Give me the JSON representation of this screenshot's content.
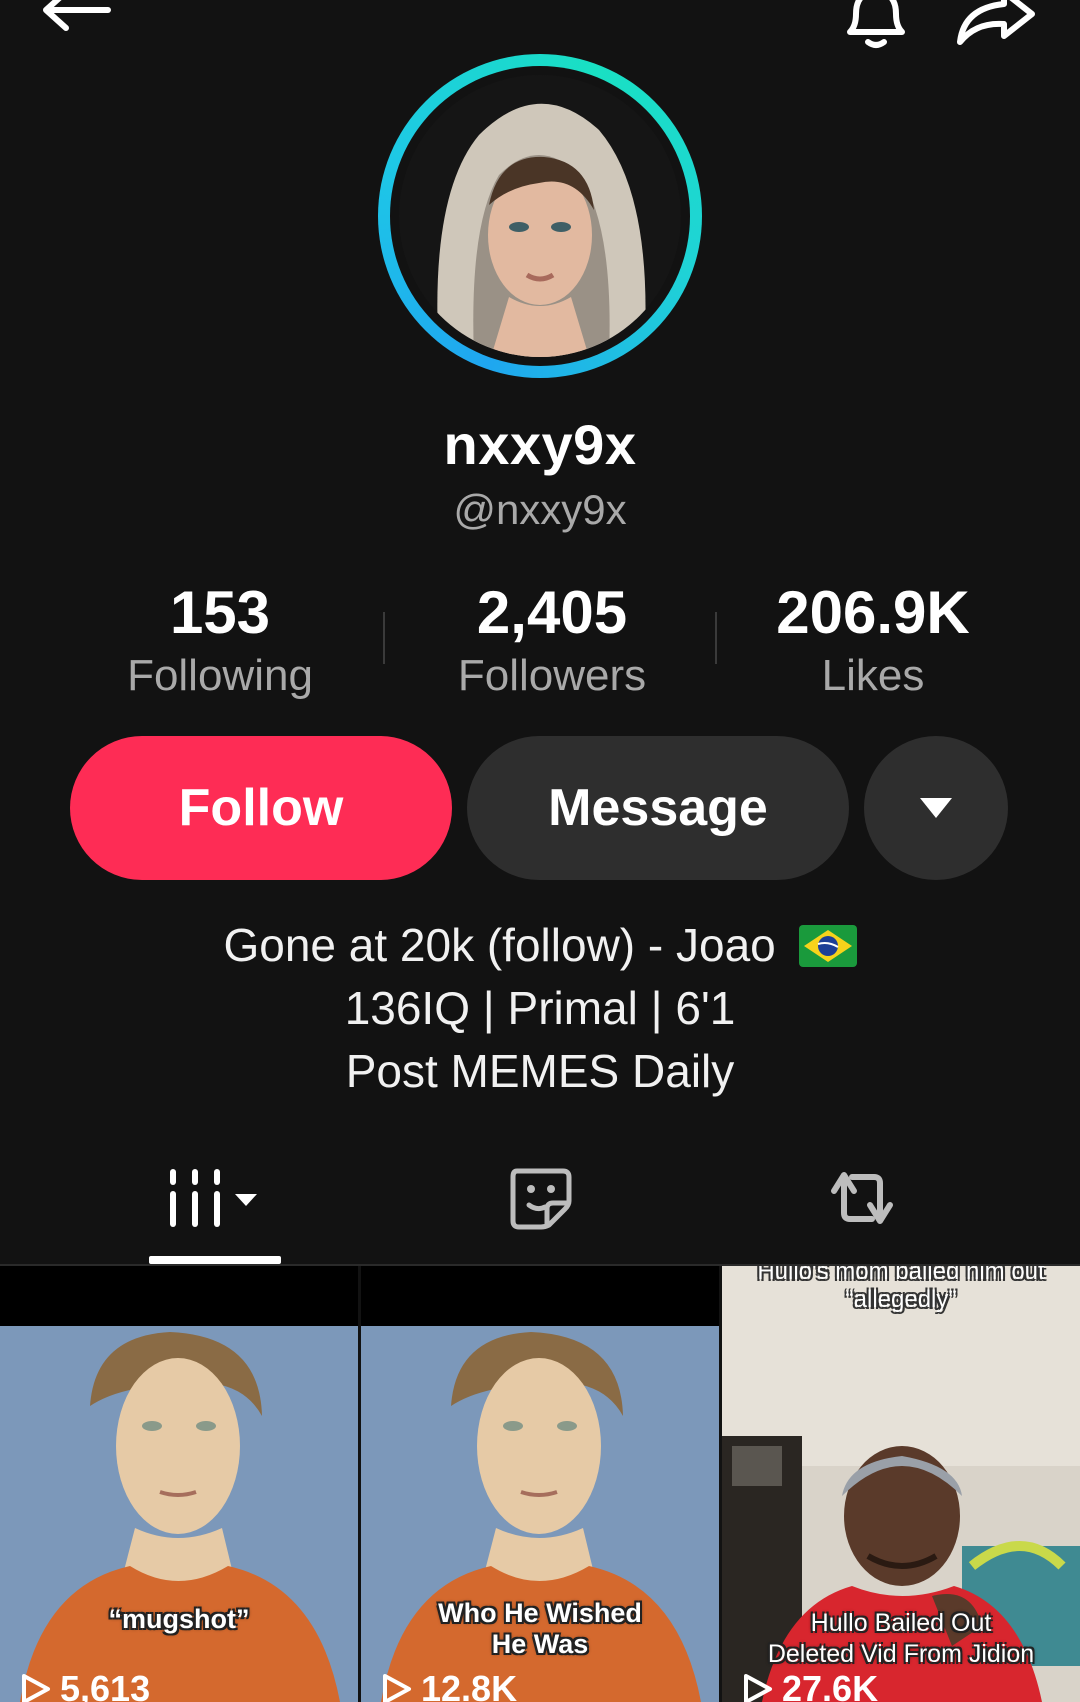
{
  "profile": {
    "display_name": "nxxy9x",
    "username": "@nxxy9x"
  },
  "stats": {
    "following": {
      "value": "153",
      "label": "Following"
    },
    "followers": {
      "value": "2,405",
      "label": "Followers"
    },
    "likes": {
      "value": "206.9K",
      "label": "Likes"
    }
  },
  "actions": {
    "follow_label": "Follow",
    "message_label": "Message"
  },
  "bio": {
    "line1": "Gone at 20k (follow) - Joao",
    "line1_emoji": "brazil-flag",
    "line2": "136IQ | Primal | 6'1",
    "line3": "Post MEMES Daily"
  },
  "tabs": [
    {
      "icon": "videos-grid-icon",
      "active": true
    },
    {
      "icon": "liked-sticker-icon",
      "active": false
    },
    {
      "icon": "repost-icon",
      "active": false
    }
  ],
  "videos": [
    {
      "caption": "“mugshot”",
      "views": "5,613"
    },
    {
      "caption_line1": "Who He Wished",
      "caption_line2": "He Was",
      "views": "12.8K"
    },
    {
      "caption_top_line1": "Hullo's mom bailed him out",
      "caption_top_line2": "“allegedly”",
      "caption_line1": "Hullo Bailed Out",
      "caption_line2": "Deleted Vid From Jidion",
      "views": "27.6K"
    }
  ],
  "colors": {
    "background": "#121212",
    "follow_button": "#fe2c55",
    "secondary_button": "#2e2e2e",
    "muted_text": "#a9a9a9",
    "avatar_ring_start": "#1fa6f0",
    "avatar_ring_end": "#19e0c3"
  }
}
